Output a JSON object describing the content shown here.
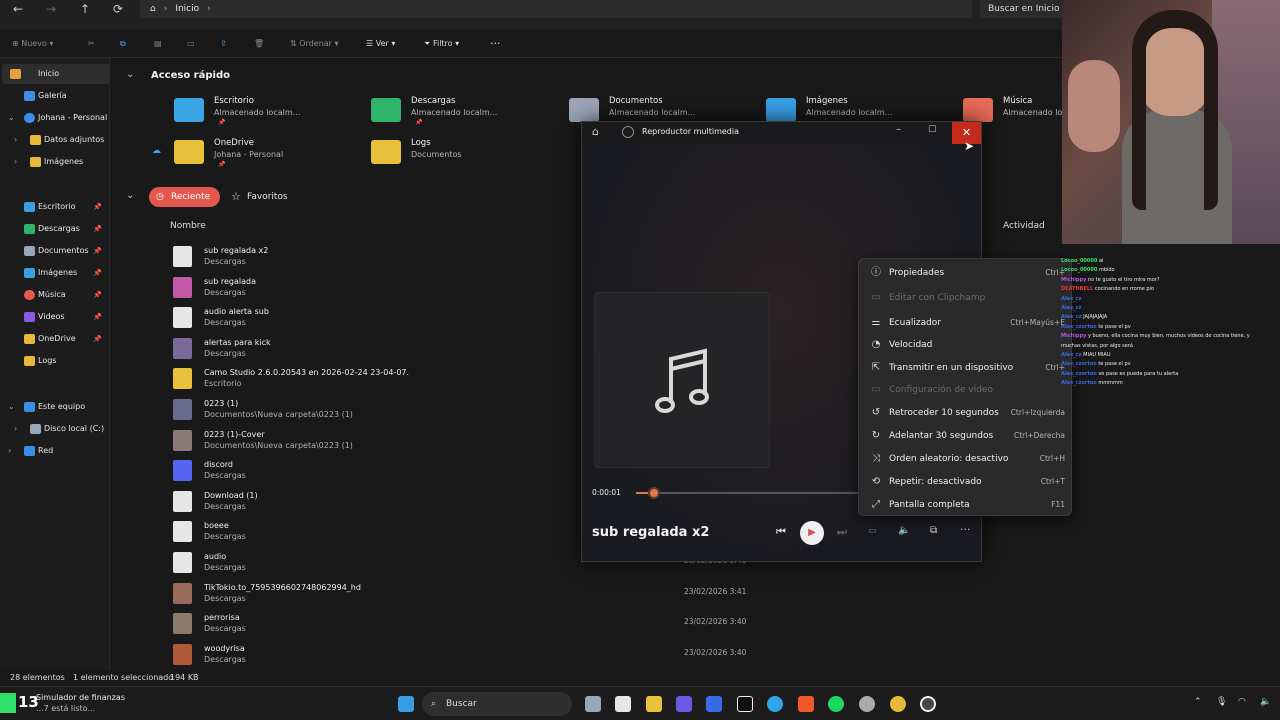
{
  "explorer": {
    "nav": {
      "back": "←",
      "forward": "→",
      "up": "↑",
      "refresh": "⟳"
    },
    "address": [
      "Inicio"
    ],
    "search_placeholder": "Buscar en Inicio",
    "toolbar": {
      "new": "Nuevo",
      "sort": "Ordenar",
      "view": "Ver",
      "filter": "Filtro",
      "more": "···"
    },
    "sidebar": [
      {
        "label": "Inicio",
        "selected": true,
        "color": "#e8a33b"
      },
      {
        "label": "Galería",
        "color": "#3a8ee6"
      },
      {
        "label": "Johana - Personal",
        "color": "#3a8ee6"
      },
      {
        "label": "Datos adjuntos",
        "color": "#e8b83b"
      },
      {
        "label": "Imágenes",
        "color": "#e8b83b"
      },
      {
        "label": "Escritorio",
        "color": "#3a9ee6",
        "pinned": true
      },
      {
        "label": "Descargas",
        "color": "#2fb36a",
        "pinned": true
      },
      {
        "label": "Documentos",
        "color": "#9aa6b8",
        "pinned": true
      },
      {
        "label": "Imágenes",
        "color": "#3aa0e6",
        "pinned": true
      },
      {
        "label": "Música",
        "color": "#e55a4a",
        "pinned": true
      },
      {
        "label": "Videos",
        "color": "#8a5ae6",
        "pinned": true
      },
      {
        "label": "OneDrive",
        "color": "#e8b83b",
        "pinned": true
      },
      {
        "label": "Logs",
        "color": "#e8b83b"
      },
      {
        "label": "Este equipo",
        "color": "#3a8ee6"
      },
      {
        "label": "Disco local (C:)",
        "color": "#9aa6b8"
      },
      {
        "label": "Red",
        "color": "#3a8ee6"
      }
    ],
    "quick_access_title": "Acceso rápido",
    "quick_access": [
      {
        "name": "Escritorio",
        "sub": "Almacenado localm...",
        "color": "#3aa6e6"
      },
      {
        "name": "Descargas",
        "sub": "Almacenado localm...",
        "color": "#2fb36a"
      },
      {
        "name": "Documentos",
        "sub": "Almacenado localm...",
        "color": "#9aa6b8"
      },
      {
        "name": "Imágenes",
        "sub": "Almacenado localm...",
        "color": "#3aa0e6"
      },
      {
        "name": "Música",
        "sub": "Almacenado lo",
        "color": "#e86a55"
      },
      {
        "name": "OneDrive",
        "sub": "Johana - Personal",
        "color": "#e8c23b"
      },
      {
        "name": "Logs",
        "sub": "Documentos",
        "color": "#e8c23b"
      }
    ],
    "tabs": {
      "recent": "Reciente",
      "favorites": "Favoritos"
    },
    "columns": {
      "name": "Nombre",
      "activity": "Actividad"
    },
    "files": [
      {
        "name": "sub regalada x2",
        "loc": "Descargas",
        "date": "",
        "thumb": "#e6e6e6"
      },
      {
        "name": "sub regalada",
        "loc": "Descargas",
        "date": "",
        "thumb": "#c25aa8"
      },
      {
        "name": "audio alerta sub",
        "loc": "Descargas",
        "date": "",
        "thumb": "#e6e6e6"
      },
      {
        "name": "alertas para kick",
        "loc": "Descargas",
        "date": "",
        "thumb": "#7a6a9a"
      },
      {
        "name": "Camo Studio 2.6.0.20543 en 2026-02-24 23-04-07.",
        "loc": "Escritorio",
        "date": "",
        "thumb": "#e8c23b"
      },
      {
        "name": "0223 (1)",
        "loc": "Documentos\\Nueva carpeta\\0223 (1)",
        "date": "",
        "thumb": "#6a6a8a"
      },
      {
        "name": "0223 (1)-Cover",
        "loc": "Documentos\\Nueva carpeta\\0223 (1)",
        "date": "",
        "thumb": "#8a7a7a"
      },
      {
        "name": "discord",
        "loc": "Descargas",
        "date": "",
        "thumb": "#5865f2"
      },
      {
        "name": "Download (1)",
        "loc": "Descargas",
        "date": "",
        "thumb": "#e6e6e6"
      },
      {
        "name": "boeee",
        "loc": "Descargas",
        "date": "",
        "thumb": "#e6e6e6"
      },
      {
        "name": "audio",
        "loc": "Descargas",
        "date": "23/02/2026 3:41",
        "thumb": "#e6e6e6"
      },
      {
        "name": "TikTokio.to_7595396602748062994_hd",
        "loc": "Descargas",
        "date": "23/02/2026 3:41",
        "thumb": "#9a6a5a"
      },
      {
        "name": "perrorisa",
        "loc": "Descargas",
        "date": "23/02/2026 3:40",
        "thumb": "#8a7a6a"
      },
      {
        "name": "woodyrisa",
        "loc": "Descargas",
        "date": "23/02/2026 3:40",
        "thumb": "#b05a3a"
      }
    ],
    "status": {
      "count": "28 elementos",
      "selected": "1 elemento seleccionado",
      "size": "194 KB"
    }
  },
  "player": {
    "title": "Reproductor multimedia",
    "track": "sub regalada x2",
    "time": "0:00:01",
    "progress_fraction": 0.08
  },
  "context_menu": [
    {
      "icon": "ⓘ",
      "label": "Propiedades",
      "shortcut": "Ctrl+",
      "disabled": false
    },
    {
      "icon": "▭",
      "label": "Editar con Clipchamp",
      "shortcut": "",
      "disabled": true
    },
    {
      "icon": "⚌",
      "label": "Ecualizador",
      "shortcut": "Ctrl+Mayús+E",
      "disabled": false
    },
    {
      "icon": "◔",
      "label": "Velocidad",
      "shortcut": "",
      "disabled": false
    },
    {
      "icon": "⇱",
      "label": "Transmitir en un dispositivo",
      "shortcut": "Ctrl+",
      "disabled": false
    },
    {
      "icon": "▭",
      "label": "Configuración de vídeo",
      "shortcut": "",
      "disabled": true
    },
    {
      "icon": "↺",
      "label": "Retroceder 10 segundos",
      "shortcut": "Ctrl+Izquierda",
      "disabled": false
    },
    {
      "icon": "↻",
      "label": "Adelantar 30 segundos",
      "shortcut": "Ctrl+Derecha",
      "disabled": false
    },
    {
      "icon": "⤨",
      "label": "Orden aleatorio: desactivo",
      "shortcut": "Ctrl+H",
      "disabled": false
    },
    {
      "icon": "⟲",
      "label": "Repetir: desactivado",
      "shortcut": "Ctrl+T",
      "disabled": false
    },
    {
      "icon": "⤢",
      "label": "Pantalla completa",
      "shortcut": "F11",
      "disabled": false
    }
  ],
  "chat": [
    {
      "user": "Locoo_00000",
      "msg": "al",
      "color": "#3ae06a"
    },
    {
      "user": "Locoo_00000",
      "msg": "mbido",
      "color": "#3ae06a"
    },
    {
      "user": "Michippy",
      "msg": "no te gusto el tiro mira mor?",
      "color": "#b05ae6"
    },
    {
      "user": "DEATHBELL",
      "msg": "cocinando en rrome pio",
      "color": "#e63a3a"
    },
    {
      "user": "Alex_cz",
      "msg": "",
      "color": "#3a6ae6"
    },
    {
      "user": "Alex_cz",
      "msg": "",
      "color": "#3a6ae6"
    },
    {
      "user": "Alex_cz",
      "msg": "JAJAJAJAJA",
      "color": "#3a6ae6"
    },
    {
      "user": "Alex_czortoo",
      "msg": "te pase el pv",
      "color": "#3a6ae6"
    },
    {
      "user": "Michippy",
      "msg": "y bueno, ella cocina muy bien, muchos videos de cocina tiene, y",
      "color": "#b05ae6"
    },
    {
      "user": "",
      "msg": "muchas vistas, por algo será",
      "color": "#eeeeee"
    },
    {
      "user": "Alex_cz",
      "msg": "MIAU MIAU",
      "color": "#3a6ae6"
    },
    {
      "user": "Alex_czortoo",
      "msg": "te pase el pv",
      "color": "#3a6ae6"
    },
    {
      "user": "Alex_czortoo",
      "msg": "ve pase es puede para tu alerta",
      "color": "#3a6ae6"
    },
    {
      "user": "Alex_czortoo",
      "msg": "mmmmm",
      "color": "#3a6ae6"
    }
  ],
  "taskbar": {
    "search": "Buscar",
    "notification_title": "Simulador de finanzas",
    "notification_sub": "...7 está listo...",
    "badge": "13"
  }
}
